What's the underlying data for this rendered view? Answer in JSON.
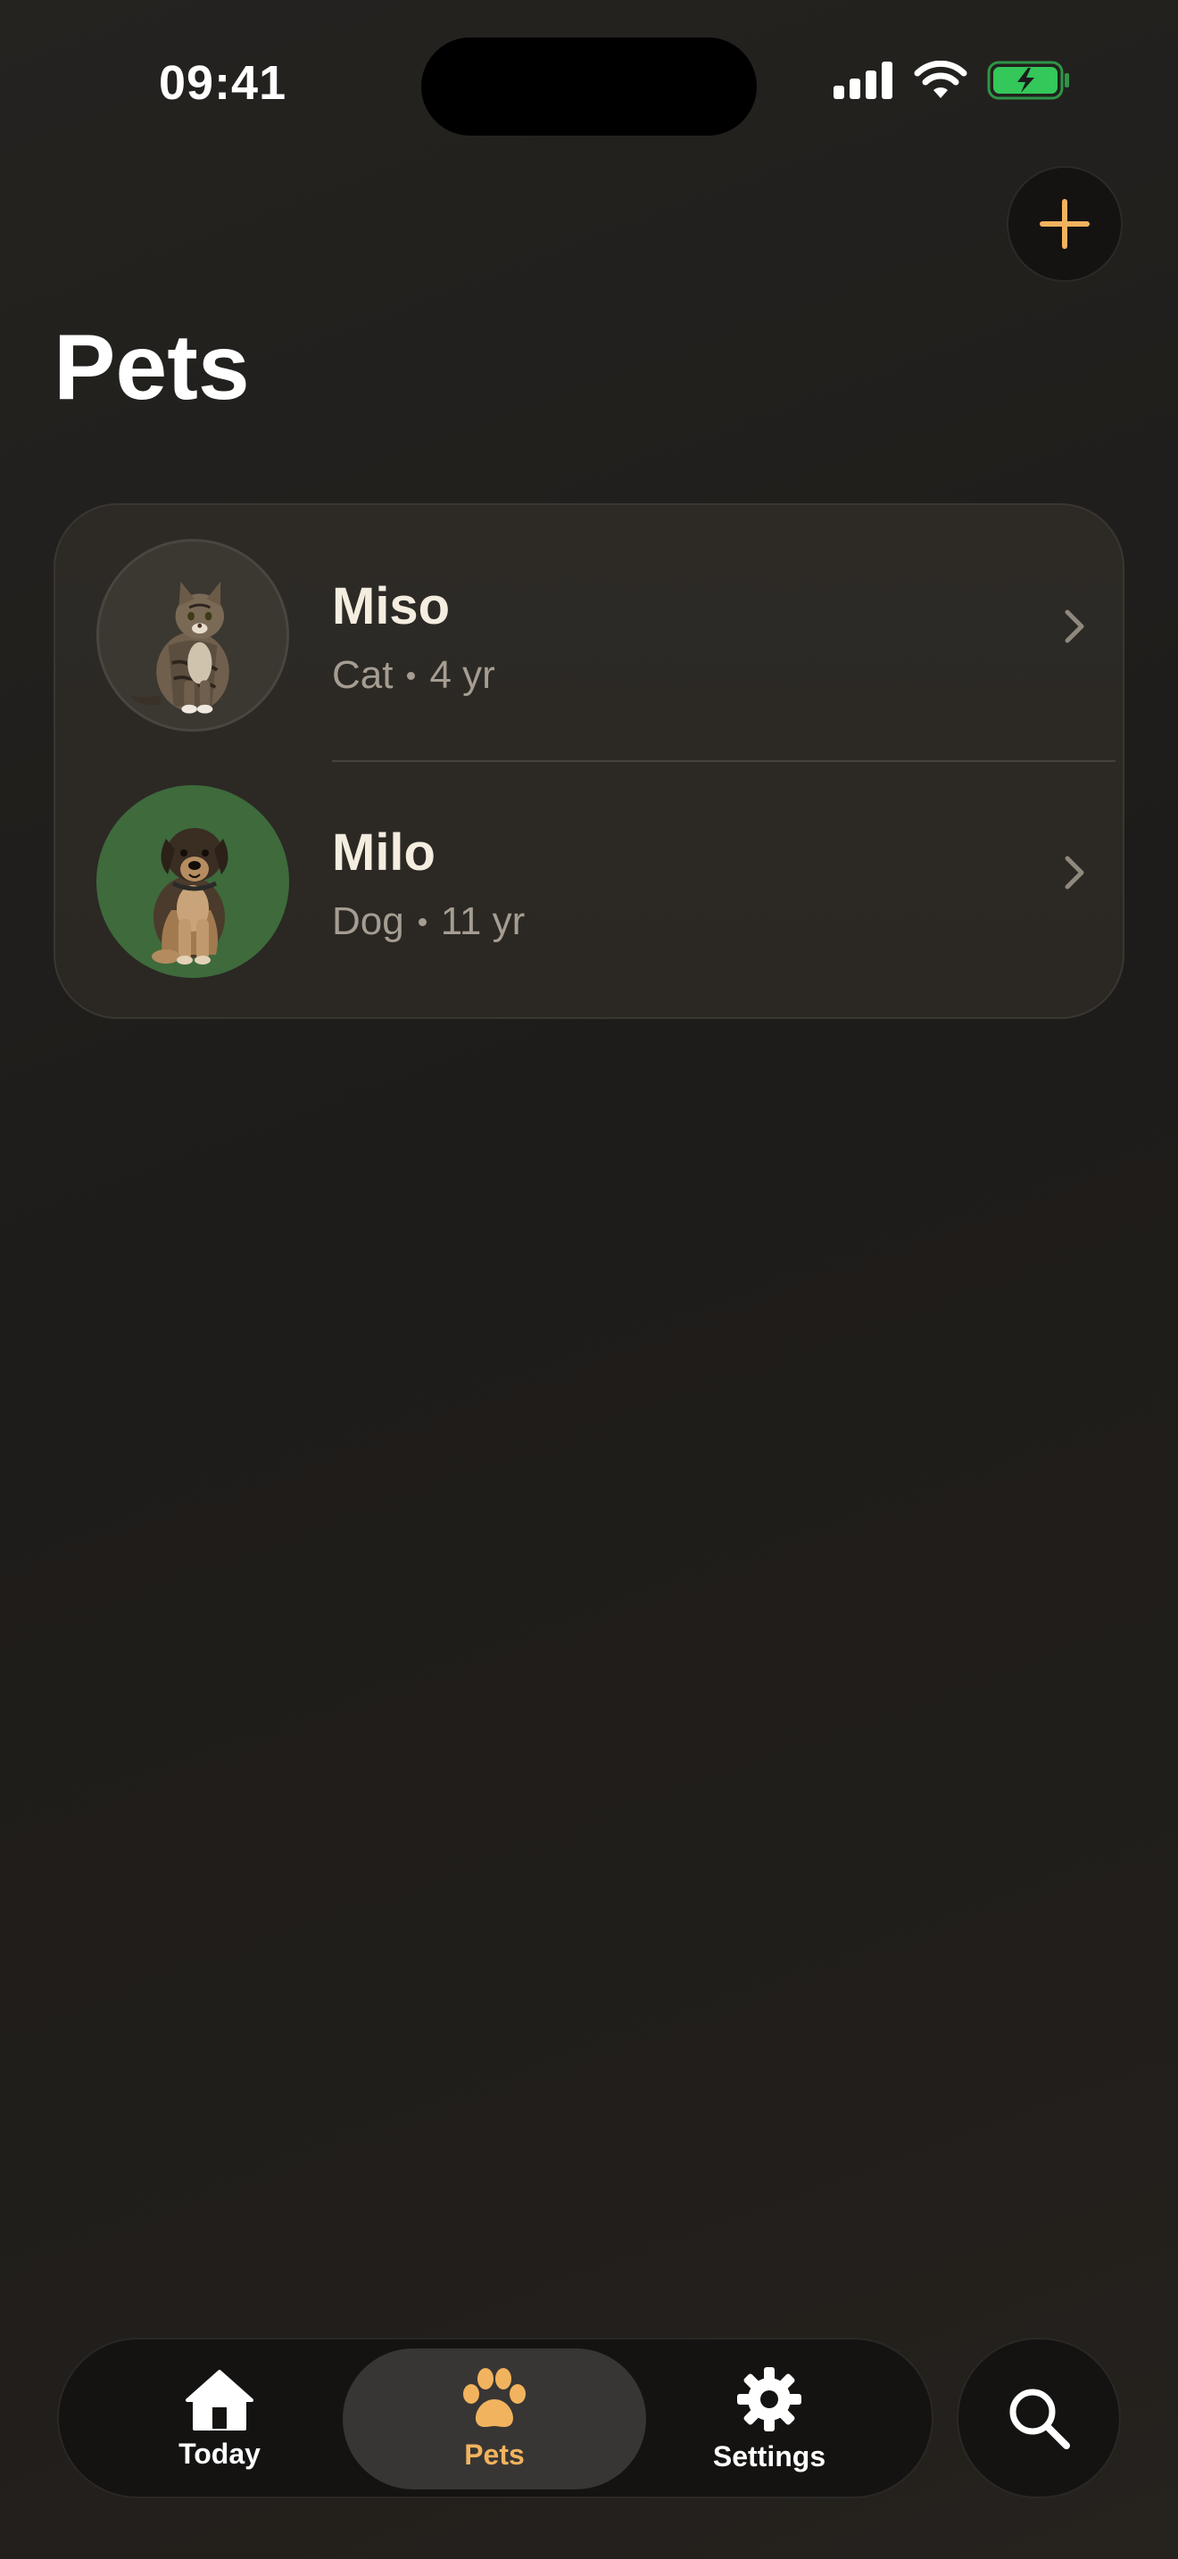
{
  "status_bar": {
    "time": "09:41"
  },
  "header": {
    "title": "Pets",
    "add_icon": "plus-icon"
  },
  "pets": [
    {
      "name": "Miso",
      "species": "Cat",
      "age": "4 yr",
      "avatar": "cat-photo"
    },
    {
      "name": "Milo",
      "species": "Dog",
      "age": "11 yr",
      "avatar": "dog-photo"
    }
  ],
  "tab_bar": {
    "tabs": [
      {
        "label": "Today",
        "icon": "house-icon",
        "selected": false
      },
      {
        "label": "Pets",
        "icon": "paw-icon",
        "selected": true
      },
      {
        "label": "Settings",
        "icon": "gear-icon",
        "selected": false
      }
    ],
    "search_icon": "search-icon"
  },
  "colors": {
    "accent": "#f2b35e",
    "battery": "#34c759",
    "dog_avatar_bg": "#3e6a3c"
  }
}
